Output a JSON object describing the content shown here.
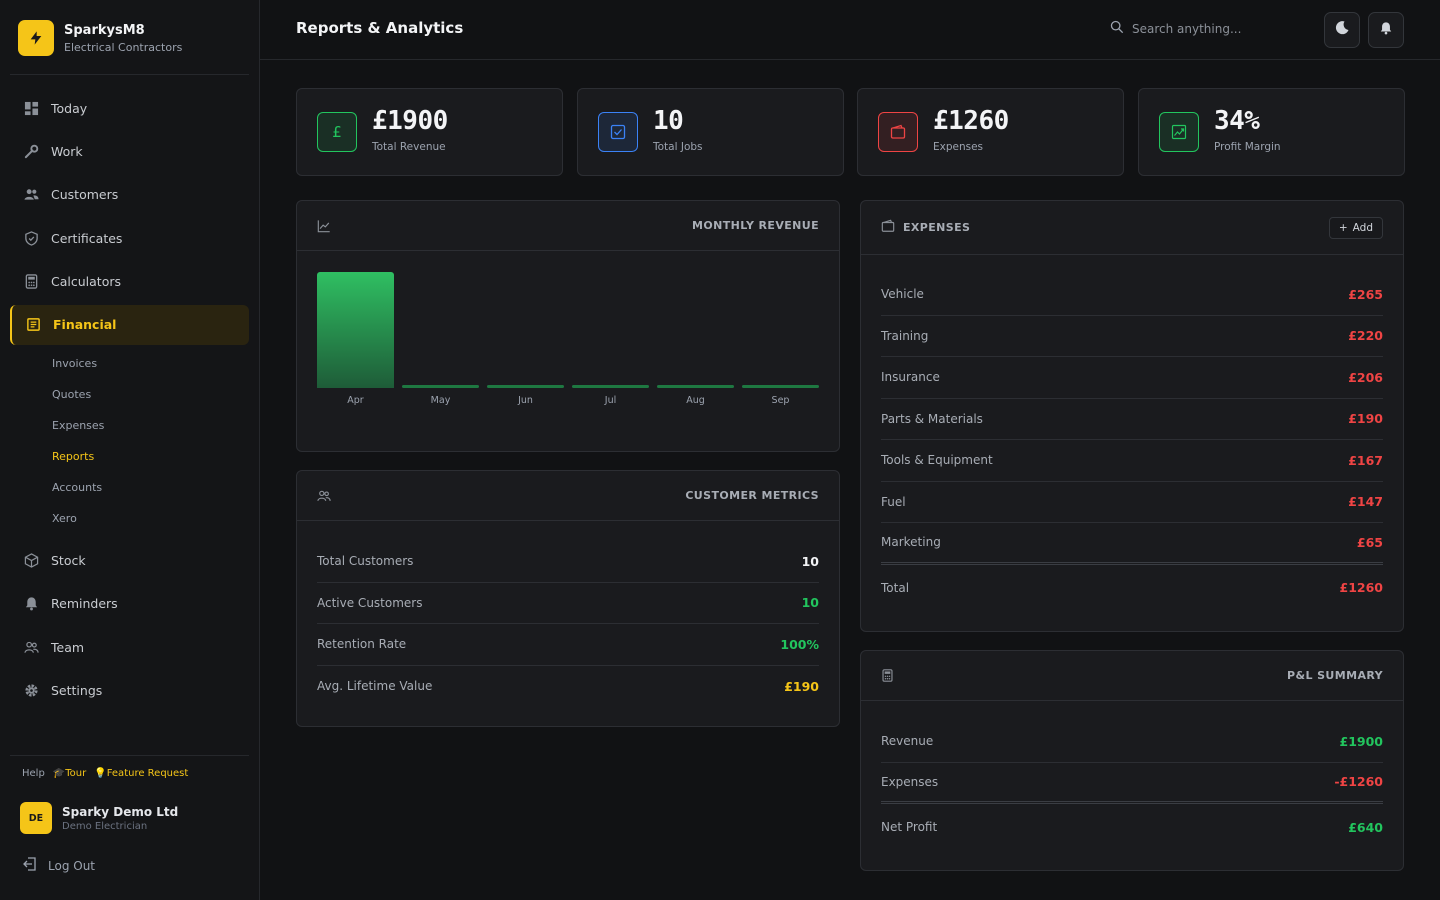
{
  "brand": {
    "name": "SparkysM8",
    "subtitle": "Electrical Contractors"
  },
  "nav": {
    "today": "Today",
    "work": "Work",
    "customers": "Customers",
    "certificates": "Certificates",
    "calculators": "Calculators",
    "financial": "Financial",
    "sub": [
      "Invoices",
      "Quotes",
      "Expenses",
      "Reports",
      "Accounts",
      "Xero"
    ],
    "stock": "Stock",
    "reminders": "Reminders",
    "team": "Team",
    "settings": "Settings"
  },
  "footer": {
    "help": "Help",
    "tour": "Tour",
    "feature": "Feature Request",
    "user_initials": "DE",
    "user_name": "Sparky Demo Ltd",
    "user_role": "Demo Electrician",
    "logout": "Log Out"
  },
  "header": {
    "title": "Reports & Analytics",
    "search_placeholder": "Search anything..."
  },
  "stats": [
    {
      "value": "£1900",
      "label": "Total Revenue",
      "icon": "pound-icon",
      "color": "#22c55e"
    },
    {
      "value": "10",
      "label": "Total Jobs",
      "icon": "check-square-icon",
      "color": "#3b82f6"
    },
    {
      "value": "£1260",
      "label": "Expenses",
      "icon": "wallet-icon",
      "color": "#ef4444"
    },
    {
      "value": "34%",
      "label": "Profit Margin",
      "icon": "trending-up-icon",
      "color": "#22c55e"
    }
  ],
  "monthly_revenue": {
    "title": "MONTHLY REVENUE"
  },
  "chart_data": {
    "type": "bar",
    "categories": [
      "Apr",
      "May",
      "Jun",
      "Jul",
      "Aug",
      "Sep"
    ],
    "values": [
      1900,
      0,
      0,
      0,
      0,
      0
    ],
    "title": "MONTHLY REVENUE",
    "xlabel": "",
    "ylabel": "",
    "grid": false,
    "color": "#22c55e"
  },
  "customer_metrics": {
    "title": "CUSTOMER METRICS",
    "rows": [
      {
        "label": "Total Customers",
        "value": "10"
      },
      {
        "label": "Active Customers",
        "value": "10"
      },
      {
        "label": "Retention Rate",
        "value": "100%"
      },
      {
        "label": "Avg. Lifetime Value",
        "value": "£190"
      }
    ]
  },
  "expenses": {
    "title": "EXPENSES",
    "add_label": "Add",
    "rows": [
      {
        "label": "Vehicle",
        "value": "£265"
      },
      {
        "label": "Training",
        "value": "£220"
      },
      {
        "label": "Insurance",
        "value": "£206"
      },
      {
        "label": "Parts & Materials",
        "value": "£190"
      },
      {
        "label": "Tools & Equipment",
        "value": "£167"
      },
      {
        "label": "Fuel",
        "value": "£147"
      },
      {
        "label": "Marketing",
        "value": "£65"
      }
    ],
    "total_label": "Total",
    "total_value": "£1260"
  },
  "pnl": {
    "title": "P&L SUMMARY",
    "revenue_label": "Revenue",
    "revenue_value": "£1900",
    "expenses_label": "Expenses",
    "expenses_value": "-£1260",
    "net_label": "Net Profit",
    "net_value": "£640"
  }
}
